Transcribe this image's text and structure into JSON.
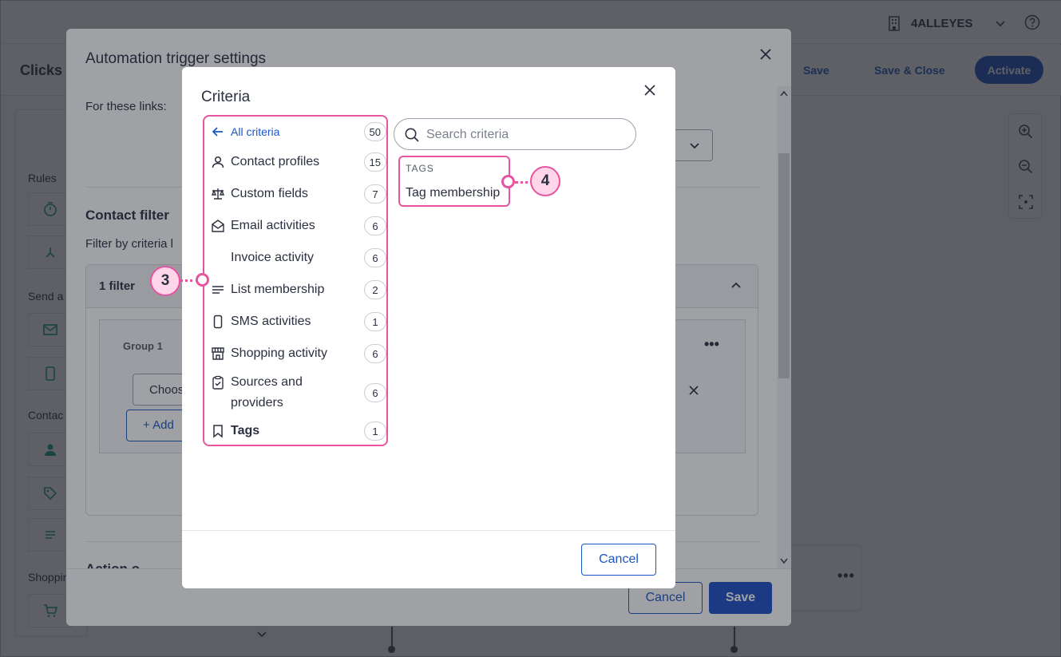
{
  "app": {
    "account_name": "4ALLEYES",
    "page_title": "Clicks t",
    "save_label": "Save",
    "save_close_label": "Save & Close",
    "activate_label": "Activate",
    "rail_labels": [
      "Rules",
      "Send a",
      "Contac",
      "Shoppin"
    ],
    "icons": [
      "building-icon",
      "chevron-down-icon",
      "help-icon",
      "zoom-in-icon",
      "zoom-out-icon",
      "focus-icon"
    ]
  },
  "trigger_modal": {
    "title": "Automation trigger settings",
    "links_label": "For these links:",
    "section_title": "Contact filter",
    "filter_by": "Filter by criteria l",
    "filter_count": "1 filter",
    "group_label": "Group 1",
    "choose_label": "Choos",
    "add_label": "+ Add",
    "next_section": "Action o",
    "cancel_label": "Cancel",
    "save_label": "Save"
  },
  "criteria_modal": {
    "title": "Criteria",
    "back_label": "All criteria",
    "back_count": "50",
    "categories": [
      {
        "label": "Contact profiles",
        "count": "15",
        "icon": "person-icon"
      },
      {
        "label": "Custom fields",
        "count": "7",
        "icon": "scale-icon"
      },
      {
        "label": "Email activities",
        "count": "6",
        "icon": "envelope-icon"
      },
      {
        "label": "Invoice activity",
        "count": "6",
        "icon": ""
      },
      {
        "label": "List membership",
        "count": "2",
        "icon": "lines-icon"
      },
      {
        "label": "SMS activities",
        "count": "1",
        "icon": "phone-icon"
      },
      {
        "label": "Shopping activity",
        "count": "6",
        "icon": "store-icon"
      },
      {
        "label": "Sources and providers",
        "count": "6",
        "icon": "clipboard-check-icon"
      },
      {
        "label": "Tags",
        "count": "1",
        "icon": "bookmark-icon"
      }
    ],
    "search_placeholder": "Search criteria",
    "result_group": "TAGS",
    "result_option": "Tag membership",
    "cancel_label": "Cancel"
  },
  "callouts": [
    "3",
    "4"
  ],
  "colors": {
    "accent": "#1a56c4",
    "primary_button": "#1d4fc4",
    "highlight": "#e7549f",
    "callout_fill": "#ffd5e9"
  }
}
